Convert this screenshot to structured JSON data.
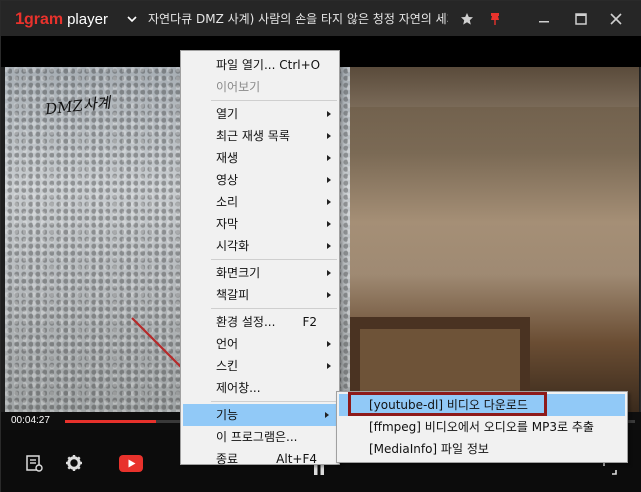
{
  "app": {
    "logo_num": "1",
    "logo_word": "gram",
    "logo_player": "player",
    "title": "자연다큐 DMZ 사계) 사람의 손을 타지 않은 청정 자연의 세계"
  },
  "video": {
    "caption": "DMZ사계"
  },
  "seek": {
    "time": "00:04:27",
    "progress": 0.16
  },
  "menu": {
    "items": [
      {
        "label": "파일 열기... Ctrl+O",
        "shortcut": ""
      },
      {
        "label": "이어보기"
      },
      {
        "label": "열기"
      },
      {
        "label": "최근 재생 목록"
      },
      {
        "label": "재생"
      },
      {
        "label": "영상"
      },
      {
        "label": "소리"
      },
      {
        "label": "자막"
      },
      {
        "label": "시각화"
      },
      {
        "label": "화면크기"
      },
      {
        "label": "책갈피"
      },
      {
        "label": "환경 설정...",
        "shortcut": "F2"
      },
      {
        "label": "언어"
      },
      {
        "label": "스킨"
      },
      {
        "label": "제어창..."
      },
      {
        "label": "기능"
      },
      {
        "label": "이 프로그램은..."
      },
      {
        "label": "종료",
        "shortcut": "Alt+F4"
      }
    ]
  },
  "submenu": {
    "items": [
      {
        "label": "[youtube-dl]  비디오 다운로드"
      },
      {
        "label": "[ffmpeg] 비디오에서 오디오를 MP3로 추출"
      },
      {
        "label": "[MediaInfo] 파일 정보"
      }
    ]
  },
  "colors": {
    "accent": "#e8322c",
    "menu_highlight": "#91c9f7",
    "annotation": "#8e1a1a"
  }
}
